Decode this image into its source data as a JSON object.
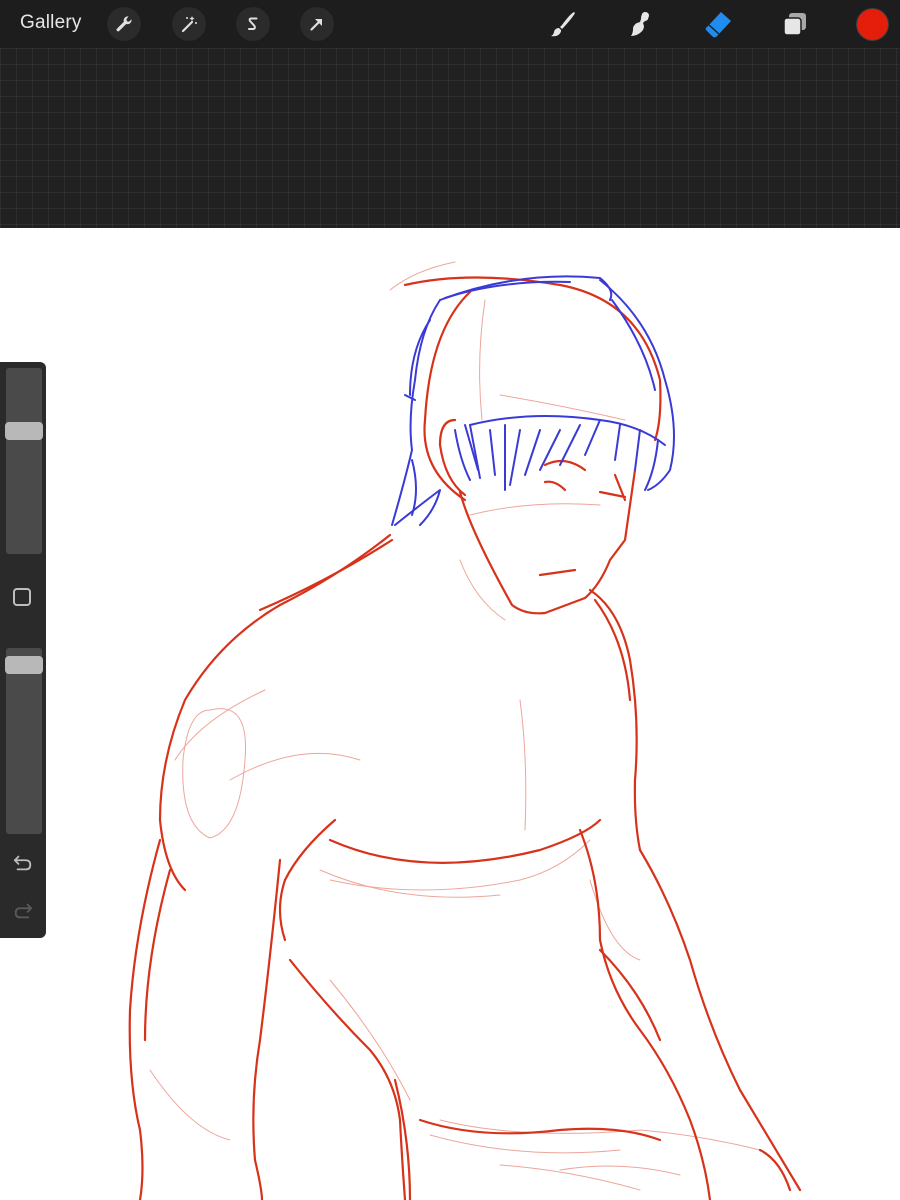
{
  "app": {
    "gallery_label": "Gallery"
  },
  "toolbar": {
    "left_tools": [
      "wrench-icon",
      "magic-wand-icon",
      "selection-s-icon",
      "transform-arrow-icon"
    ],
    "right_tools": [
      "brush-icon",
      "smudge-icon",
      "eraser-icon",
      "layers-icon"
    ],
    "active_tool": "eraser",
    "active_tool_color": "#1f8cf0",
    "current_color": "#e41e0a"
  },
  "sidebar": {
    "brush_size_level": 0.68,
    "opacity_level": 0.95,
    "controls": [
      "brush-size-slider",
      "modify-square-button",
      "opacity-slider",
      "undo-icon",
      "redo-icon"
    ]
  },
  "canvas": {
    "stroke_colors": {
      "sketch_red": "#d7321a",
      "hair_blue": "#3a3ad6",
      "light_red": "#e8887a"
    }
  }
}
